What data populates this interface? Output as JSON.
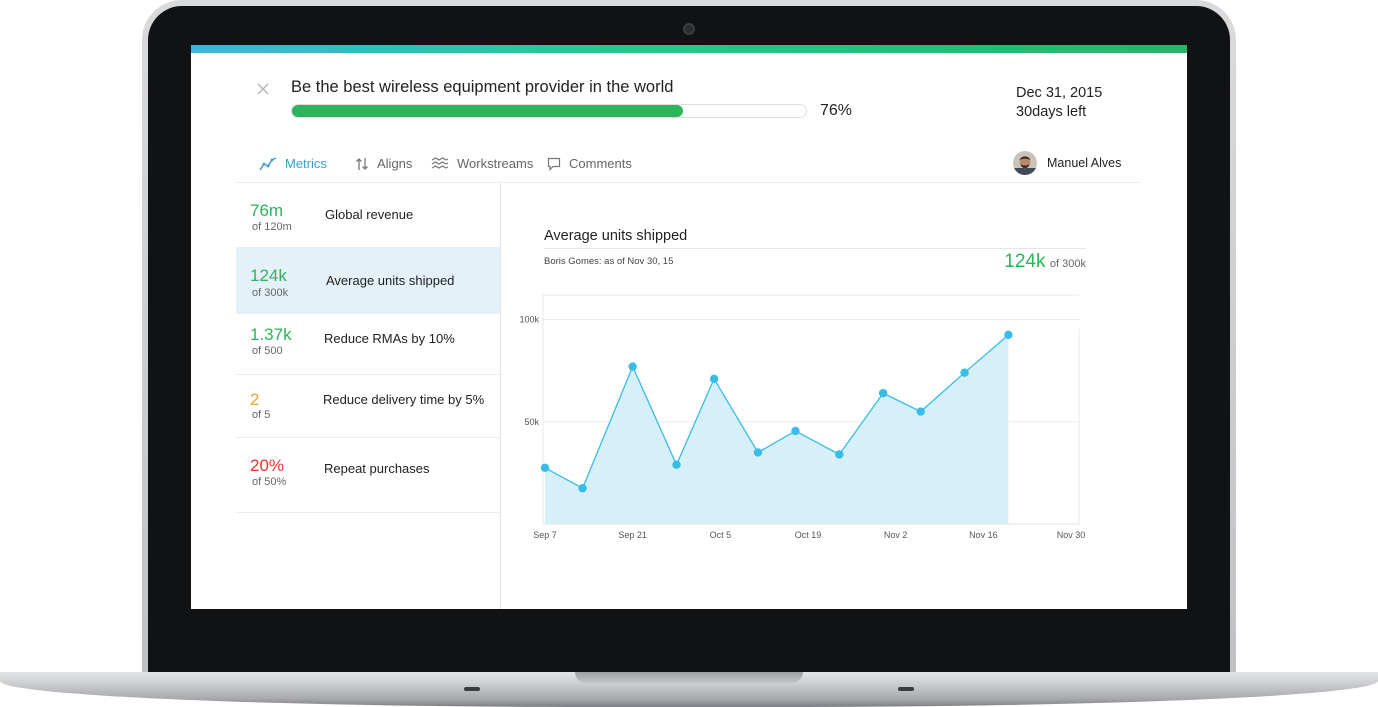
{
  "goal": {
    "title": "Be the best wireless equipment provider in the world",
    "progress_pct": 76,
    "progress_label": "76%",
    "due_date": "Dec 31, 2015",
    "days_left": "30days left"
  },
  "tabs": [
    {
      "label": "Metrics",
      "icon": "trend-line-icon",
      "active": true
    },
    {
      "label": "Aligns",
      "icon": "up-down-arrows-icon",
      "active": false
    },
    {
      "label": "Workstreams",
      "icon": "wave-lines-icon",
      "active": false
    },
    {
      "label": "Comments",
      "icon": "speech-bubble-icon",
      "active": false
    }
  ],
  "user": {
    "name": "Manuel Alves"
  },
  "metrics": [
    {
      "value": "76m",
      "target": "of 120m",
      "name": "Global revenue",
      "color": "#2cb55a",
      "selected": false
    },
    {
      "value": "124k",
      "target": "of 300k",
      "name": "Average units shipped",
      "color": "#2cb55a",
      "selected": true
    },
    {
      "value": "1.37k",
      "target": "of 500",
      "name": "Reduce RMAs by 10%",
      "color": "#2cb55a",
      "selected": false
    },
    {
      "value": "2",
      "target": "of 5",
      "name": "Reduce delivery time by 5%",
      "color": "#f0a030",
      "selected": false
    },
    {
      "value": "20%",
      "target": "of 50%",
      "name": "Repeat purchases",
      "color": "#e8352f",
      "selected": false
    }
  ],
  "detail": {
    "title": "Average units shipped",
    "author": "Boris Gomes: as of Nov 30, 15",
    "current": "124k",
    "target": "of 300k"
  },
  "colors": {
    "accent": "#3a9fcb",
    "good": "#2cb55a",
    "warn": "#f0a030",
    "bad": "#e8352f",
    "area": "#d6eff8",
    "line": "#38bde8"
  },
  "chart_data": {
    "type": "area",
    "title": "",
    "xlabel": "",
    "ylabel": "",
    "x_tick_labels": [
      "Sep 7",
      "Sep 21",
      "Oct 5",
      "Oct 19",
      "Nov 2",
      "Nov 16",
      "Nov 30"
    ],
    "y_tick_labels": [
      "50k",
      "100k"
    ],
    "y_ticks": [
      50000,
      100000
    ],
    "ylim": [
      0,
      112000
    ],
    "xlim": [
      "2015-09-07",
      "2015-11-30"
    ],
    "grid": true,
    "series": [
      {
        "x": [
          "2015-09-07",
          "2015-09-13",
          "2015-09-21",
          "2015-09-28",
          "2015-10-04",
          "2015-10-11",
          "2015-10-17",
          "2015-10-24",
          "2015-10-31",
          "2015-11-06",
          "2015-11-13",
          "2015-11-20"
        ],
        "values": [
          27500,
          17500,
          77000,
          29000,
          71000,
          35000,
          45500,
          34000,
          64000,
          55000,
          74000,
          92500
        ]
      }
    ]
  }
}
